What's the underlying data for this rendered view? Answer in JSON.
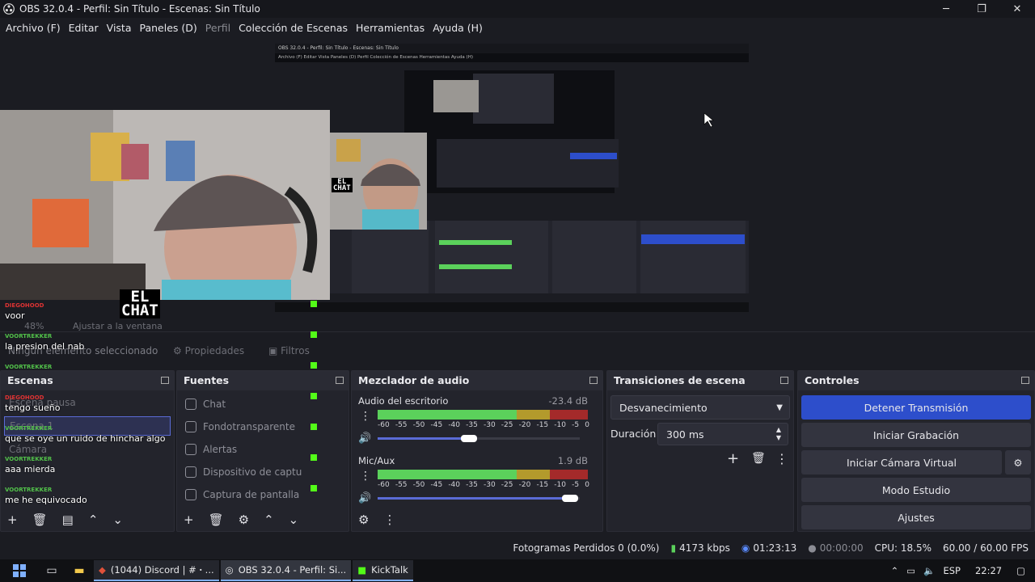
{
  "window": {
    "title": "OBS 32.0.4 - Perfil: Sin Título - Escenas: Sin Título",
    "minimize": "─",
    "maximize": "❐",
    "close": "✕"
  },
  "menu": [
    "Archivo (F)",
    "Editar",
    "Vista",
    "Paneles (D)",
    "Perfil",
    "Colección de Escenas",
    "Herramientas",
    "Ayuda (H)"
  ],
  "nested_preview": {
    "title": "OBS 32.0.4 - Perfil: Sin Título - Escenas: Sin Título",
    "menu": "Archivo (F)  Editar  Vista  Paneles (D)  Perfil  Colección de Escenas  Herramientas  Ayuda (H)"
  },
  "overlay_logo": {
    "line1": "EL",
    "line2": "CHAT"
  },
  "chat": [
    {
      "user": "DIEGOHOOD",
      "text": "voor"
    },
    {
      "user": "VOORTREKKER",
      "text": "la presion del nab"
    },
    {
      "user": "VOORTREKKER",
      "text": ""
    },
    {
      "user": "DIEGOHOOD",
      "text": "tengo sueño"
    },
    {
      "user": "VOORTREKKER",
      "text": "que se oye un ruido de hinchar algo"
    },
    {
      "user": "VOORTREKKER",
      "text": "aaa mierda"
    },
    {
      "user": "VOORTREKKER",
      "text": "me he equivocado"
    }
  ],
  "scene_toolbar": {
    "zoom": "48%",
    "fit": "Ajustar a la ventana",
    "selection": "Ningún elemento seleccionado",
    "properties": "Propiedades",
    "filters": "Filtros"
  },
  "scenes": {
    "header": "Escenas",
    "items": [
      "Escena pausa",
      "Escena 1",
      "Cámara"
    ]
  },
  "sources": {
    "header": "Fuentes",
    "items": [
      "Chat",
      "Fondotransparente",
      "Alertas",
      "Dispositivo de captu",
      "Captura de pantalla"
    ]
  },
  "mixer": {
    "header": "Mezclador de audio",
    "channels": [
      {
        "name": "Audio del escritorio",
        "db": "-23.4 dB",
        "level": 0.66,
        "volume": 0.45
      },
      {
        "name": "Mic/Aux",
        "db": "1.9 dB",
        "level": 0.72,
        "volume": 0.95
      }
    ],
    "ticks": [
      "-60",
      "-55",
      "-50",
      "-45",
      "-40",
      "-35",
      "-30",
      "-25",
      "-20",
      "-15",
      "-10",
      "-5",
      "0"
    ]
  },
  "transitions": {
    "header": "Transiciones de escena",
    "type": "Desvanecimiento",
    "duration_label": "Duración",
    "duration": "300 ms"
  },
  "controls": {
    "header": "Controles",
    "buttons": [
      "Detener Transmisión",
      "Iniciar Grabación",
      "Iniciar Cámara Virtual",
      "Modo Estudio",
      "Ajustes"
    ]
  },
  "status": {
    "dropped": "Fotogramas Perdidos 0 (0.0%)",
    "bitrate": "4173 kbps",
    "live_time": "01:23:13",
    "rec_time": "00:00:00",
    "cpu": "CPU: 18.5%",
    "fps": "60.00 / 60.00 FPS"
  },
  "taskbar": {
    "apps": [
      "(1044) Discord | # ꞏ ...",
      "OBS 32.0.4 - Perfil: Si...",
      "KickTalk"
    ],
    "lang": "ESP",
    "time": "22:27"
  },
  "colors": {
    "accent": "#2d4ecb",
    "meter_green": "#5bd15b",
    "meter_yellow": "#b39a2c",
    "meter_red": "#a42a2a",
    "kick_green": "#53fc18"
  }
}
